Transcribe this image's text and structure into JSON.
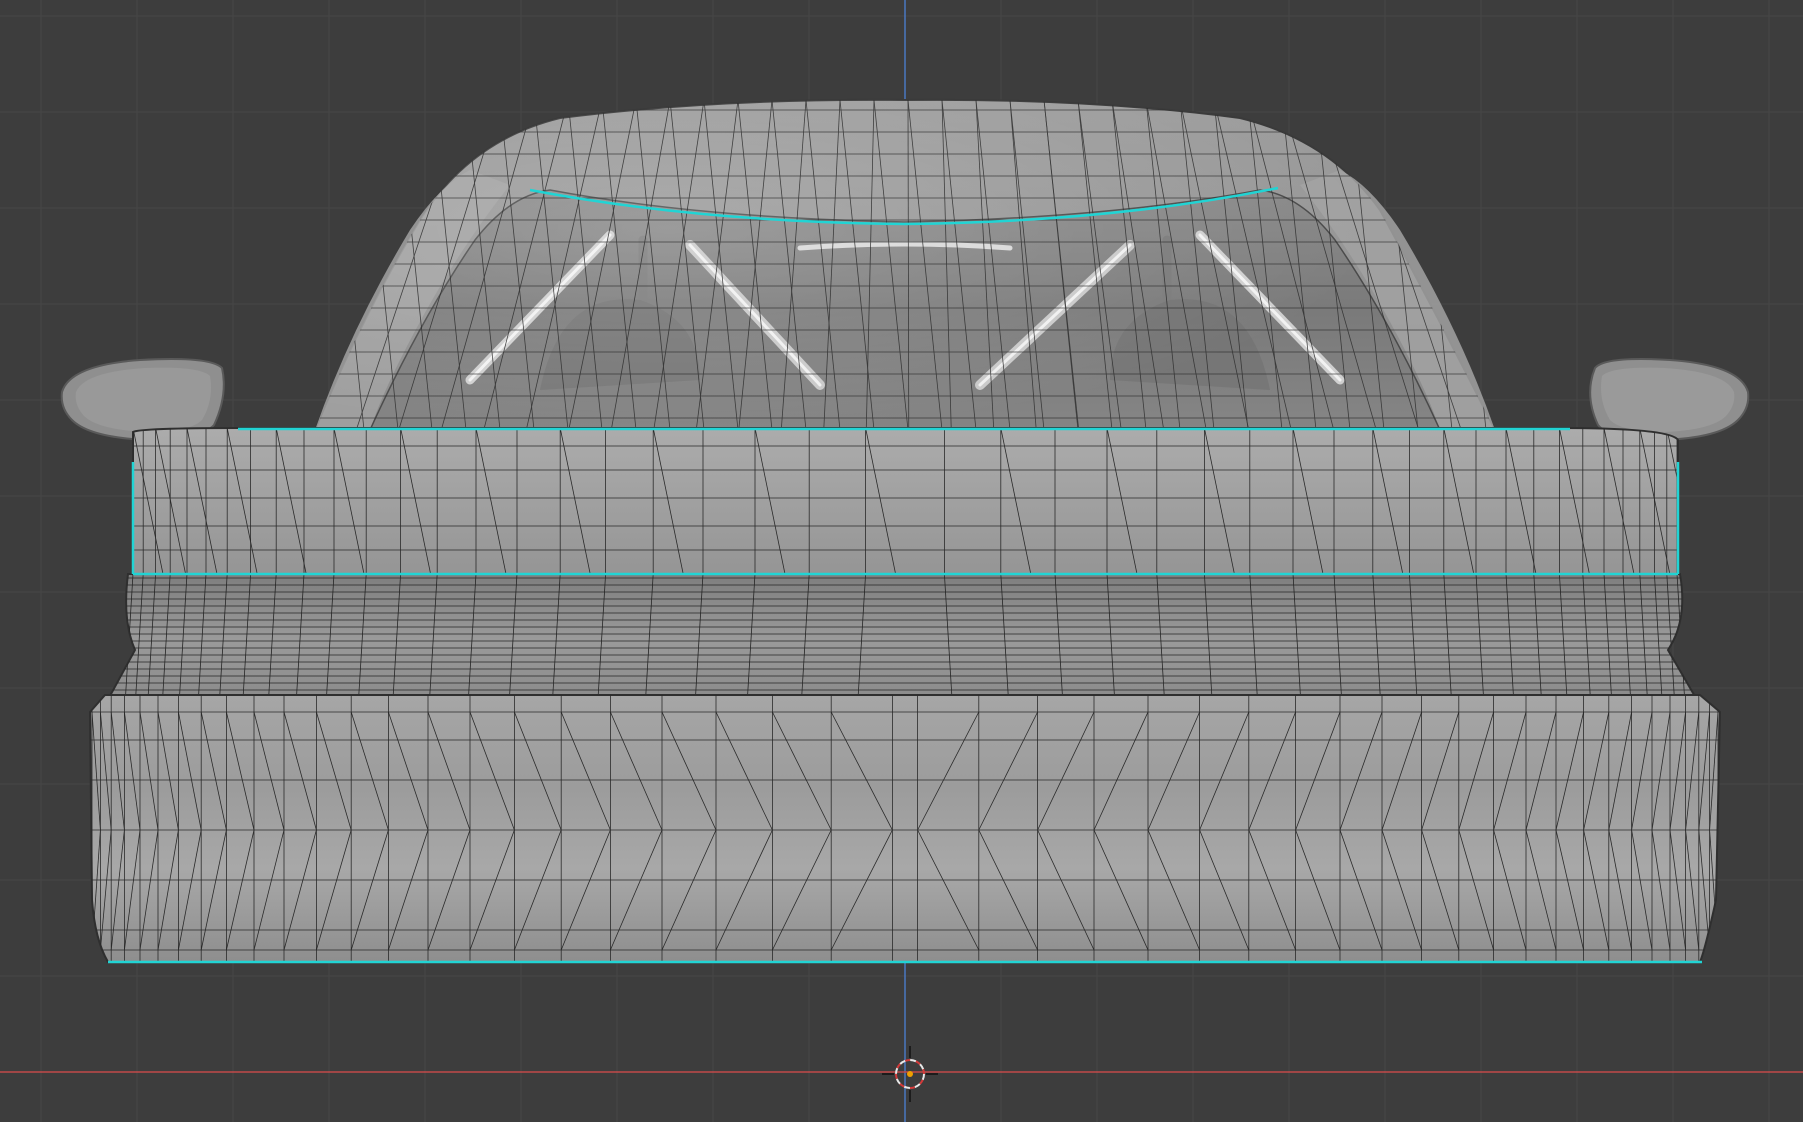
{
  "viewport": {
    "type": "3d-viewport",
    "view": "front-orthographic",
    "shading": "solid",
    "overlay": "wireframe",
    "background_color": "#3d3d3d",
    "grid_color": "#474747",
    "x_axis_color": "#c24a4a",
    "z_axis_color": "#4a78c2",
    "selection_color": "#21d4d4"
  },
  "scene": {
    "object": "car-body-mesh",
    "mode": "edit-mode",
    "selected_edge_loops": 4,
    "cursor_icon": "3d-cursor-icon"
  }
}
